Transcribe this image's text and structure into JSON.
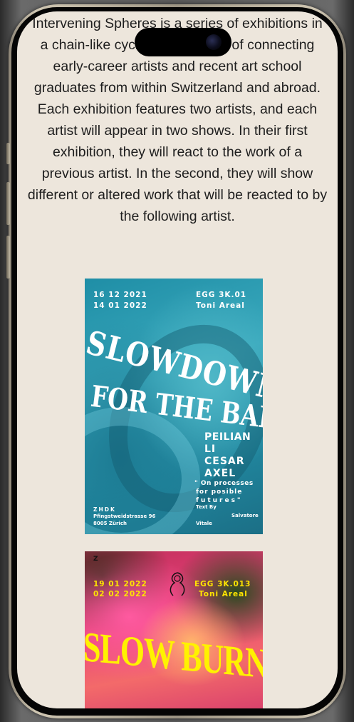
{
  "intro_text": "Intervening Spheres is a series of exhibitions in a chain-like cycle with the goal of connecting early-career artists and recent art school graduates from within Switzerland and abroad. Each exhibition features two artists, and each artist will appear in two shows. In their first exhibition, they will react to the work of a previous artist. In the second, they will show different or altered work that will be reacted to by the following artist.",
  "posters": [
    {
      "dates_line1": "16   12   2021",
      "dates_line2": "14   01   2022",
      "venue_line1": "EGG      3K.01",
      "venue_line2": "Toni Areal",
      "title_word1": "SLOWDOWN",
      "title_word2": "FOR THE BABY",
      "artist1_a": "PEILIAN",
      "artist1_b": "LI",
      "artist2_a": "CESAR",
      "artist2_b": "AXEL",
      "tagline1": "\" On processes",
      "tagline2": "for      posible",
      "tagline3": "futures\"",
      "school": "ZHDK",
      "address1": "Pfingstweidstrasse 96",
      "address2": "8005 Zürich",
      "text_by_label": "Text By",
      "text_by_name1": "Salvatore",
      "text_by_name2": "Vitale"
    },
    {
      "logo_letter": "Z",
      "dates_line1": "19   01   2022",
      "dates_line2": "02   02   2022",
      "venue_line1": "EGG    3K.013",
      "venue_line2": "Toni Areal",
      "title": "SLOW BURNER"
    }
  ],
  "colors": {
    "page_background": "#ede6dc",
    "poster1_base": "#2a9cb3",
    "poster2_base": "#e9427a",
    "poster2_title": "#fff200"
  }
}
